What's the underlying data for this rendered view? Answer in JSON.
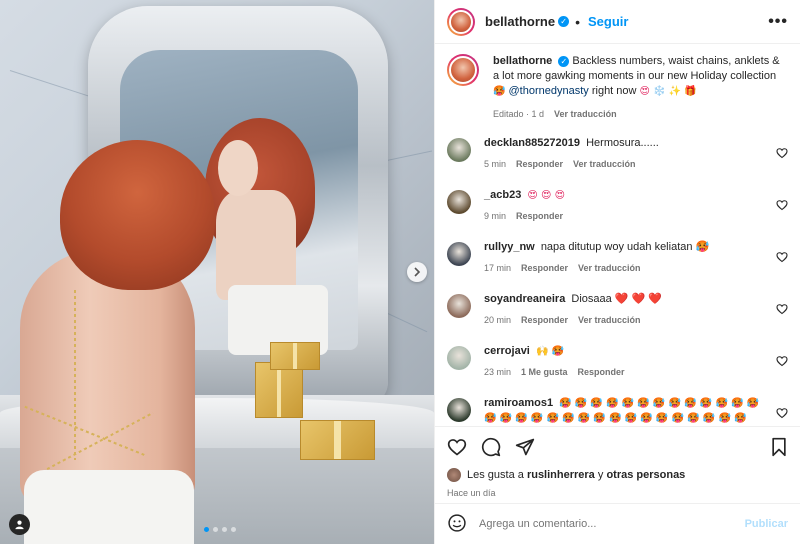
{
  "post": {
    "username": "bellathorne",
    "follow_label": "Seguir",
    "separator": "•",
    "more_label": "•••"
  },
  "caption": {
    "username": "bellathorne",
    "text_before": "Backless numbers, waist chains, anklets & a lot more gawking moments in our new Holiday collection",
    "emoji_1": "🥵",
    "mention": "@thornedynasty",
    "text_after": "right now",
    "emoji_tail": "😍 ❄️ ✨ 🎁",
    "edited": "Editado",
    "time": "1 d",
    "translate_label": "Ver traducción"
  },
  "comments": [
    {
      "username": "decklan885272019",
      "text": "Hermosura......",
      "time": "5 min",
      "reply_label": "Responder",
      "translate_label": "Ver traducción",
      "likes_label": "",
      "avatar_color": "#6b7a5e"
    },
    {
      "username": "_acb23",
      "text": "😍 😍 😍",
      "time": "9 min",
      "reply_label": "Responder",
      "translate_label": "",
      "likes_label": "",
      "avatar_color": "#5d4a2f"
    },
    {
      "username": "rullyy_nw",
      "text": "napa ditutup woy udah keliatan 🥵",
      "time": "17 min",
      "reply_label": "Responder",
      "translate_label": "Ver traducción",
      "likes_label": "",
      "avatar_color": "#3d4552"
    },
    {
      "username": "soyandreaneira",
      "text": "Diosaaa ❤️ ❤️ ❤️",
      "time": "20 min",
      "reply_label": "Responder",
      "translate_label": "Ver traducción",
      "likes_label": "",
      "avatar_color": "#8c6a5a"
    },
    {
      "username": "cerrojavi",
      "text": "🙌 🥵",
      "time": "23 min",
      "reply_label": "Responder",
      "translate_label": "",
      "likes_label": "1 Me gusta",
      "avatar_color": "#a3b4a8"
    },
    {
      "username": "ramiroamos1",
      "text": "🥵 🥵 🥵 🥵 🥵 🥵 🥵 🥵 🥵 🥵 🥵 🥵 🥵 🥵 🥵 🥵 🥵 🥵 🥵 🥵 🥵 🥵 🥵 🥵 🥵 🥵 🥵 🥵 🥵 🥵",
      "time": "",
      "reply_label": "",
      "translate_label": "",
      "likes_label": "",
      "avatar_color": "#2d3b2d"
    }
  ],
  "likes": {
    "prefix": "Les gusta a",
    "user": "ruslinherrera",
    "joiner": "y",
    "others": "otras personas"
  },
  "posted_ago": "Hace un día",
  "comment_box": {
    "placeholder": "Agrega un comentario...",
    "post_label": "Publicar"
  },
  "icons": {
    "like": "heart-icon",
    "comment": "comment-icon",
    "share": "share-icon",
    "save": "bookmark-icon",
    "emoji": "emoji-icon",
    "next": "chevron-right-icon",
    "tag": "user-tag-icon"
  },
  "colors": {
    "accent": "#0095f6",
    "muted": "#737373",
    "post_disabled": "#b2dffc"
  },
  "carousel": {
    "total_slides": 4,
    "active_index": 0
  }
}
